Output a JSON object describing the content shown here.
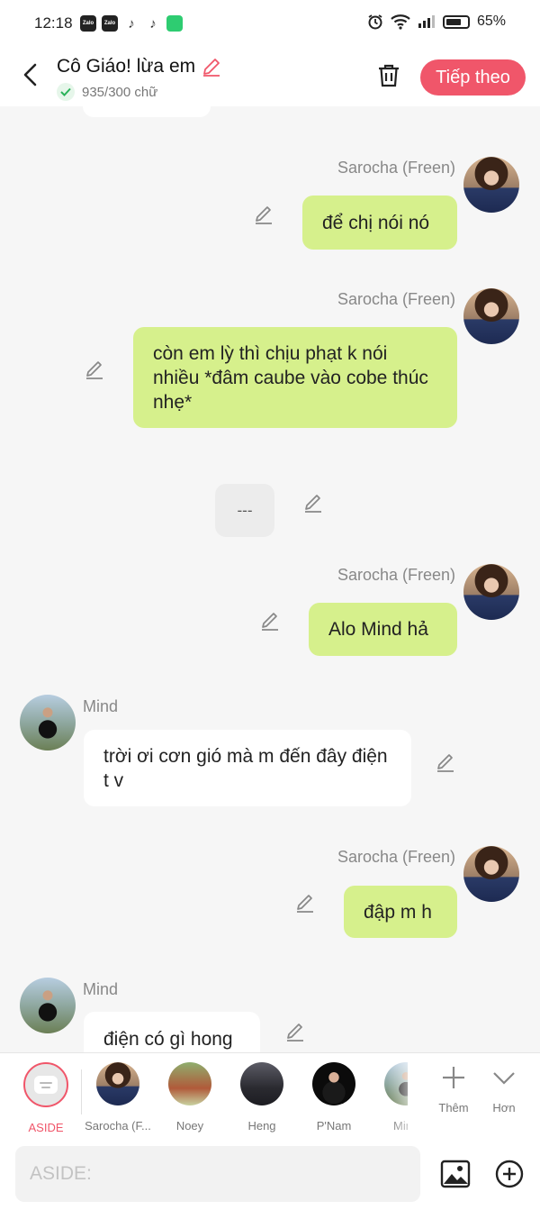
{
  "status_bar": {
    "time": "12:18",
    "battery": "65%",
    "app_icons": [
      {
        "name": "zalo-icon",
        "text": "Zalo"
      },
      {
        "name": "zalo-icon",
        "text": "Zalo"
      },
      {
        "name": "tiktok-icon",
        "text": "♪"
      },
      {
        "name": "tiktok-icon",
        "text": "♪"
      },
      {
        "name": "messages-icon",
        "text": ""
      }
    ]
  },
  "header": {
    "title": "Cô Giáo! lừa em",
    "char_count": "935/300 chữ",
    "next_label": "Tiếp theo",
    "accent": "#f0566a"
  },
  "chat": {
    "messages": [
      {
        "id": "m1",
        "sender": "Sarocha (Freen)",
        "side": "right",
        "text": "để chị nói nó"
      },
      {
        "id": "m2",
        "sender": "Sarocha (Freen)",
        "side": "right",
        "text": "còn em lỳ thì chịu phạt k nói nhiều *đâm caube vào cobe thúc nhẹ*"
      },
      {
        "id": "m3",
        "sender": "",
        "side": "center",
        "text": "---"
      },
      {
        "id": "m4",
        "sender": "Sarocha (Freen)",
        "side": "right",
        "text": "Alo Mind hả"
      },
      {
        "id": "m5",
        "sender": "Mind",
        "side": "left",
        "text": "trời ơi cơn gió mà m đến đây điện t v"
      },
      {
        "id": "m6",
        "sender": "Sarocha (Freen)",
        "side": "right",
        "text": "đập m h"
      },
      {
        "id": "m7",
        "sender": "Mind",
        "side": "left",
        "text": "điện có gì hong"
      }
    ],
    "bubble_color_self": "#d6f08c",
    "bubble_color_other": "#ffffff"
  },
  "characters": {
    "items": [
      {
        "label": "ASIDE",
        "selected": true
      },
      {
        "label": "Sarocha (F...",
        "selected": false
      },
      {
        "label": "Noey",
        "selected": false
      },
      {
        "label": "Heng",
        "selected": false
      },
      {
        "label": "P'Nam",
        "selected": false
      },
      {
        "label": "Mind",
        "selected": false
      }
    ],
    "add_label": "Thêm",
    "more_label": "Hơn"
  },
  "composer": {
    "placeholder": "ASIDE:",
    "value": ""
  }
}
